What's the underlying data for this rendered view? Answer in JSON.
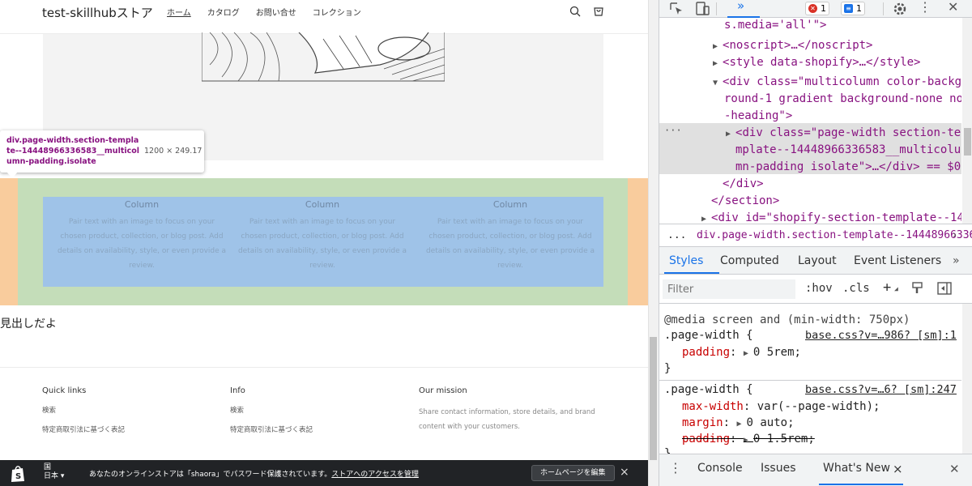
{
  "site": {
    "logo": "test-skillhubストア",
    "nav": [
      "ホーム",
      "カタログ",
      "お問い合せ",
      "コレクション"
    ],
    "icons": {
      "search": "search-icon",
      "cart": "cart-icon"
    }
  },
  "inspector_tooltip": {
    "selector": "div.page-width.section-template--14448966336583__multicolumn-padding.isolate",
    "size": "1200 × 249.17"
  },
  "multicolumn": {
    "columns": [
      {
        "title": "Column",
        "text": "Pair text with an image to focus on your chosen product, collection, or blog post. Add details on availability, style, or even provide a review."
      },
      {
        "title": "Column",
        "text": "Pair text with an image to focus on your chosen product, collection, or blog post. Add details on availability, style, or even provide a review."
      },
      {
        "title": "Column",
        "text": "Pair text with an image to focus on your chosen product, collection, or blog post. Add details on availability, style, or even provide a review."
      }
    ]
  },
  "heading": "見出しだよ",
  "footer": {
    "quick_links": {
      "title": "Quick links",
      "links": [
        "検索",
        "特定商取引法に基づく表記"
      ]
    },
    "info": {
      "title": "Info",
      "links": [
        "検索",
        "特定商取引法に基づく表記"
      ]
    },
    "mission": {
      "title": "Our mission",
      "text": "Share contact information, store details, and brand content with your customers."
    }
  },
  "admin_bar": {
    "country_label": "国",
    "country_value": "日本",
    "message": "あなたのオンラインストアは「shaora」でパスワード保護されています。",
    "link": "ストアへのアクセスを管理",
    "edit_button": "ホームページを編集",
    "close": "×"
  },
  "devtools": {
    "toolbar": {
      "errors": "1",
      "messages": "1",
      "more": "»"
    },
    "elements": [
      {
        "indent": 0,
        "text": "s.media='all'\">"
      },
      {
        "indent": 1,
        "text": "<noscript>…</noscript>"
      },
      {
        "indent": 1,
        "text": "<style data-shopify>…</style>"
      },
      {
        "indent": 1,
        "text": "<div class=\"multicolumn color-backg"
      },
      {
        "indent": 2,
        "text": "round-1 gradient background-none no"
      },
      {
        "indent": 2,
        "text": "-heading\">"
      },
      {
        "indent": 3,
        "text": "<div class=\"page-width section-te"
      },
      {
        "indent": 4,
        "text": "mplate--14448966336583__multicolu"
      },
      {
        "indent": 4,
        "text": "mn-padding isolate\">…</div> == $0"
      },
      {
        "indent": 2,
        "text": "</div>"
      },
      {
        "indent": 1,
        "text": "</section>"
      },
      {
        "indent": 1,
        "text": "<div id=\"shopify-section-template--14"
      }
    ],
    "breadcrumb": "div.page-width.section-template--14448966336583",
    "breadcrumb_dots": "...",
    "styles_tabs": [
      "Styles",
      "Computed",
      "Layout",
      "Event Listeners",
      "»"
    ],
    "filter_placeholder": "Filter",
    "filter_buttons": [
      ":hov",
      ".cls",
      "+"
    ],
    "rules": [
      {
        "media": "@media screen and (min-width: 750px)",
        "selector": ".page-width {",
        "source": "base.css?v=…986? [sm]:1",
        "props": [
          {
            "name": "padding",
            "value": "0 5rem",
            "struck": false
          }
        ]
      },
      {
        "media": "",
        "selector": ".page-width {",
        "source": "base.css?v=…6? [sm]:247",
        "props": [
          {
            "name": "max-width",
            "value": "var(--page-width)",
            "struck": false
          },
          {
            "name": "margin",
            "value": "0 auto",
            "struck": false
          },
          {
            "name": "padding",
            "value": "0 1.5rem",
            "struck": true
          }
        ]
      }
    ],
    "drawer_tabs": [
      "Console",
      "Issues",
      "What's New"
    ],
    "drawer_close": "×"
  }
}
